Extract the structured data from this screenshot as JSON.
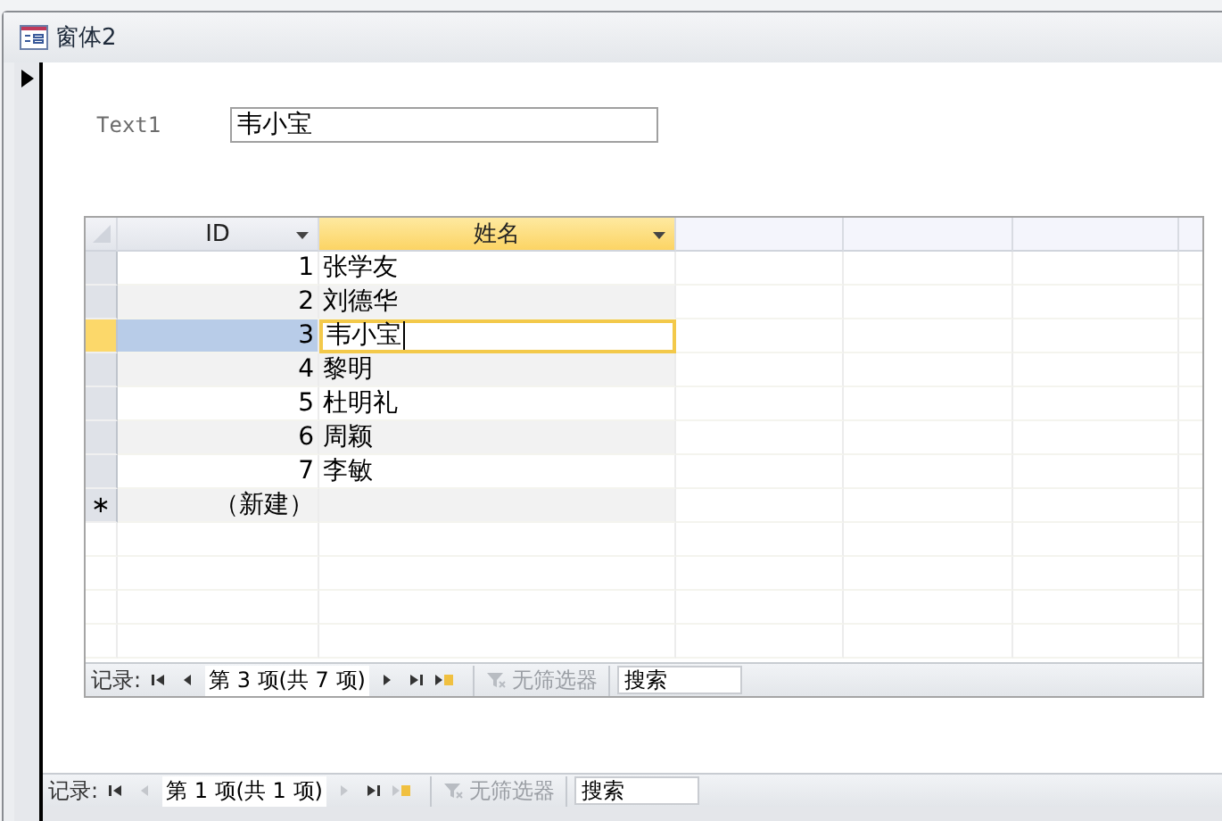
{
  "window": {
    "title": "窗体2"
  },
  "form": {
    "field": {
      "label": "Text1",
      "value": "韦小宝"
    }
  },
  "datasheet": {
    "columns": [
      {
        "label": "ID",
        "selected": false
      },
      {
        "label": "姓名",
        "selected": true
      }
    ],
    "rows": [
      {
        "id": "1",
        "name": "张学友",
        "selected": false
      },
      {
        "id": "2",
        "name": "刘德华",
        "selected": false
      },
      {
        "id": "3",
        "name": "韦小宝",
        "selected": true
      },
      {
        "id": "4",
        "name": "黎明",
        "selected": false
      },
      {
        "id": "5",
        "name": "杜明礼",
        "selected": false
      },
      {
        "id": "6",
        "name": "周颖",
        "selected": false
      },
      {
        "id": "7",
        "name": "李敏",
        "selected": false
      }
    ],
    "new_row": {
      "marker": "∗",
      "id": "（新建）"
    },
    "navigator": {
      "label": "记录:",
      "position": "第 3 项(共 7 项)",
      "filter": "无筛选器",
      "search": "搜索",
      "buttons": [
        {
          "kind": "first",
          "disabled": false
        },
        {
          "kind": "previous",
          "disabled": false
        },
        {
          "kind": "next",
          "disabled": false
        },
        {
          "kind": "last",
          "disabled": false
        },
        {
          "kind": "new",
          "disabled": false
        }
      ]
    }
  },
  "navigator": {
    "label": "记录:",
    "position": "第 1 项(共 1 项)",
    "filter": "无筛选器",
    "search": "搜索",
    "buttons": [
      {
        "kind": "first",
        "disabled": false
      },
      {
        "kind": "previous",
        "disabled": true
      },
      {
        "kind": "next",
        "disabled": true
      },
      {
        "kind": "last",
        "disabled": false
      },
      {
        "kind": "new",
        "disabled": true
      }
    ]
  }
}
